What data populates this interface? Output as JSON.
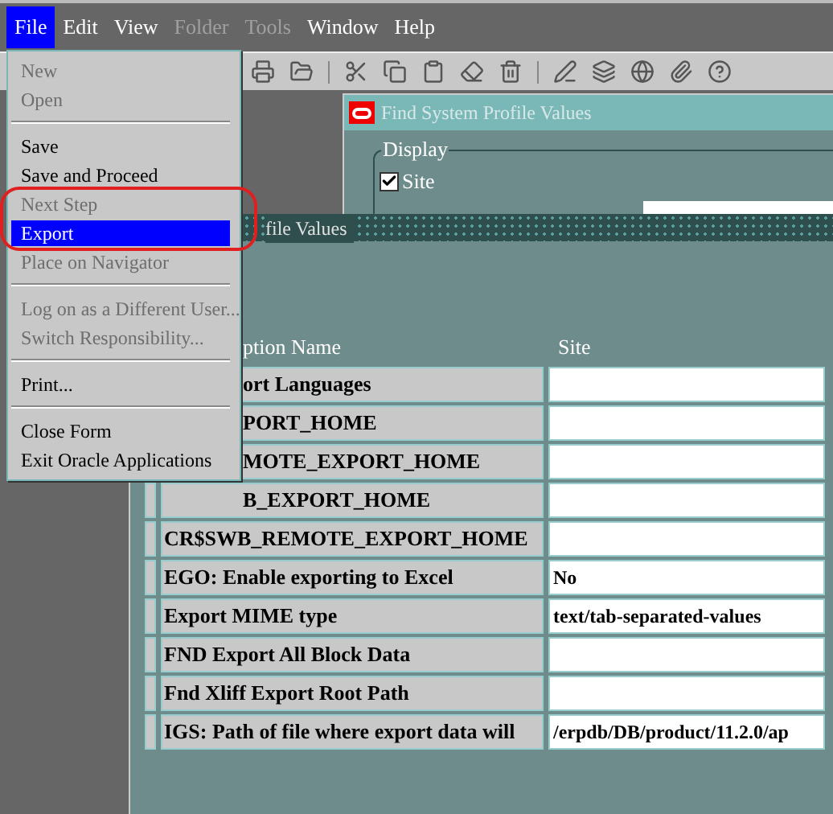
{
  "menubar": [
    {
      "label": "File",
      "selected": true,
      "disabled": false
    },
    {
      "label": "Edit",
      "selected": false,
      "disabled": false
    },
    {
      "label": "View",
      "selected": false,
      "disabled": false
    },
    {
      "label": "Folder",
      "selected": false,
      "disabled": true
    },
    {
      "label": "Tools",
      "selected": false,
      "disabled": true
    },
    {
      "label": "Window",
      "selected": false,
      "disabled": false
    },
    {
      "label": "Help",
      "selected": false,
      "disabled": false
    }
  ],
  "file_menu": {
    "groups": [
      [
        {
          "label": "New",
          "disabled": true,
          "selected": false
        },
        {
          "label": "Open",
          "disabled": true,
          "selected": false
        }
      ],
      [
        {
          "label": "Save",
          "disabled": false,
          "selected": false
        },
        {
          "label": "Save and Proceed",
          "disabled": false,
          "selected": false
        },
        {
          "label": "Next Step",
          "disabled": true,
          "selected": false
        },
        {
          "label": "Export",
          "disabled": false,
          "selected": true
        },
        {
          "label": "Place on Navigator",
          "disabled": true,
          "selected": false
        }
      ],
      [
        {
          "label": "Log on as a Different User...",
          "disabled": true,
          "selected": false
        },
        {
          "label": "Switch Responsibility...",
          "disabled": true,
          "selected": false
        }
      ],
      [
        {
          "label": "Print...",
          "disabled": false,
          "selected": false
        }
      ],
      [
        {
          "label": "Close Form",
          "disabled": false,
          "selected": false
        },
        {
          "label": "Exit Oracle Applications",
          "disabled": false,
          "selected": false
        }
      ]
    ]
  },
  "find_window": {
    "title": "Find System Profile Values",
    "group_label": "Display",
    "checkbox": {
      "label": "Site",
      "checked": true
    }
  },
  "profile_window": {
    "title": "file Values",
    "columns": [
      {
        "label": "ption Name",
        "kind": "clipped"
      },
      {
        "label": "Site",
        "kind": "full"
      }
    ],
    "rows": [
      {
        "name": "ort Languages",
        "value": "",
        "kind": "clipped"
      },
      {
        "name": "PORT_HOME",
        "value": "",
        "kind": "clipped"
      },
      {
        "name": "MOTE_EXPORT_HOME",
        "value": "",
        "kind": "clipped"
      },
      {
        "name": "B_EXPORT_HOME",
        "value": "",
        "kind": "clipped"
      },
      {
        "name": "CR$SWB_REMOTE_EXPORT_HOME",
        "value": "",
        "kind": "full"
      },
      {
        "name": "EGO: Enable exporting to Excel",
        "value": "No",
        "kind": "full"
      },
      {
        "name": "Export MIME type",
        "value": "text/tab-separated-values",
        "kind": "full"
      },
      {
        "name": "FND Export All Block Data",
        "value": "",
        "kind": "full"
      },
      {
        "name": "Fnd Xliff Export Root Path",
        "value": "",
        "kind": "full"
      },
      {
        "name": "IGS: Path of file where export data will",
        "value": "/erpdb/DB/product/11.2.0/ap",
        "kind": "full"
      }
    ]
  }
}
